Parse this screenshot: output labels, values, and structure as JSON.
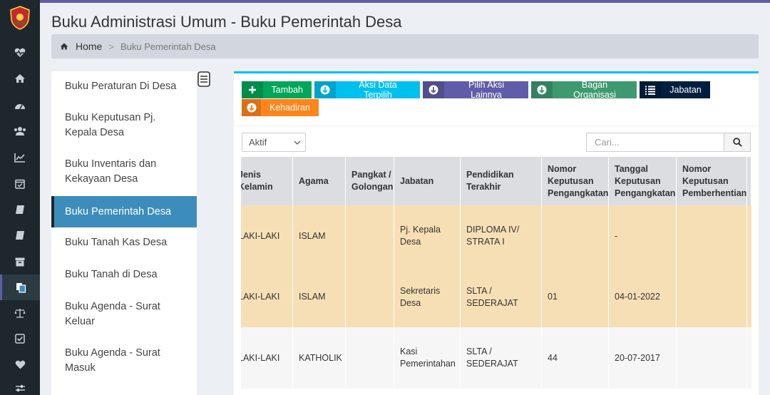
{
  "page": {
    "title": "Buku Administrasi Umum - Buku Pemerintah Desa",
    "breadcrumb": {
      "home": "Home",
      "separator": ">",
      "current": "Buku Pemerintah Desa"
    }
  },
  "rail_icons": [
    "heartbeat-icon",
    "home-icon",
    "dashboard-icon",
    "users-icon",
    "chart-icon",
    "calendar-icon",
    "book-icon",
    "book-icon",
    "archive-icon",
    "copy-icon",
    "balance-scale-icon",
    "check-square-icon",
    "heart-icon",
    "sliders-icon"
  ],
  "left_menu": [
    {
      "label": "Buku Peraturan Di Desa"
    },
    {
      "label": "Buku Keputusan Pj. Kepala Desa"
    },
    {
      "label": "Buku Inventaris dan Kekayaan Desa"
    },
    {
      "label": "Buku Pemerintah Desa",
      "active": true
    },
    {
      "label": "Buku Tanah Kas Desa"
    },
    {
      "label": "Buku Tanah di Desa"
    },
    {
      "label": "Buku Agenda - Surat Keluar"
    },
    {
      "label": "Buku Agenda - Surat Masuk"
    }
  ],
  "toolbar": {
    "tambah": "Tambah",
    "aksi_data": "Aksi Data Terpilih",
    "pilih_aksi": "Pilih Aksi Lainnya",
    "bagan": "Bagan Organisasi",
    "jabatan": "Jabatan",
    "kehadiran": "Kehadiran"
  },
  "filter": {
    "status_selected": "Aktif",
    "search_placeholder": "Cari..."
  },
  "colors": {
    "green": "#00a65a",
    "aqua": "#00c0ef",
    "purple": "#605ca8",
    "olive": "#3d9970",
    "navy": "#001f3f",
    "orange": "#ff851b",
    "row_highlight": "#f7dfb5"
  },
  "table": {
    "headers": [
      "Jenis Kelamin",
      "Agama",
      "Pangkat / Golongan",
      "Jabatan",
      "Pendidikan Terakhir",
      "Nomor Keputusan Pengangkatan",
      "Tanggal Keputusan Pengangkatan",
      "Nomor Keputusan Pemberhentian"
    ],
    "rows": [
      {
        "jk": "LAKI-LAKI",
        "agama": "ISLAM",
        "pangkat": "",
        "jabatan": "Pj. Kepala Desa",
        "pendidikan": "DIPLOMA IV/ STRATA I",
        "no_angkat": "",
        "tgl_angkat": "-",
        "no_henti": ""
      },
      {
        "jk": "LAKI-LAKI",
        "agama": "ISLAM",
        "pangkat": "",
        "jabatan": "Sekretaris Desa",
        "pendidikan": "SLTA / SEDERAJAT",
        "no_angkat": "01",
        "tgl_angkat": "04-01-2022",
        "no_henti": ""
      },
      {
        "jk": "LAKI-LAKI",
        "agama": "KATHOLIK",
        "pangkat": "",
        "jabatan": "Kasi Pemerintahan",
        "pendidikan": "SLTA / SEDERAJAT",
        "no_angkat": "44",
        "tgl_angkat": "20-07-2017",
        "no_henti": ""
      }
    ]
  }
}
